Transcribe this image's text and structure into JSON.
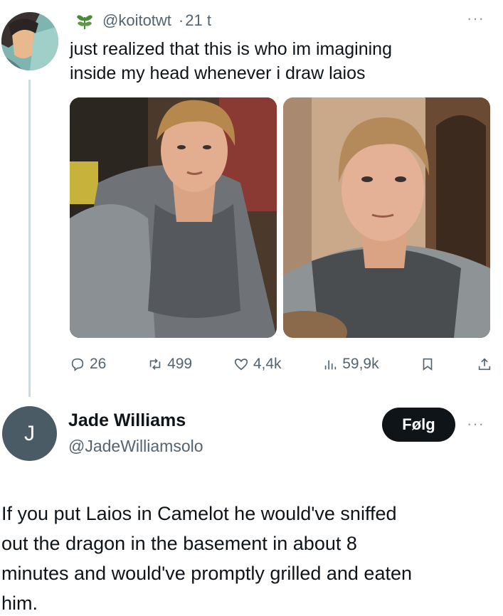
{
  "tweet": {
    "handle": "@koitotwt",
    "separator": "·",
    "time": "21 t",
    "more": "···",
    "text_line1": "just realized that this is who im imagining",
    "text_line2": "inside my head whenever i draw laios",
    "stats": {
      "replies": "26",
      "reposts": "499",
      "likes": "4,4k",
      "views": "59,9k"
    },
    "icons": {
      "badge": "leaf-icon",
      "reply": "reply-icon",
      "repost": "repost-icon",
      "like": "heart-icon",
      "views": "views-icon",
      "bookmark": "bookmark-icon",
      "share": "share-icon"
    }
  },
  "reply": {
    "avatar_letter": "J",
    "name": "Jade Williams",
    "handle": "@JadeWilliamsolo",
    "follow_label": "Følg",
    "more": "···",
    "text_line1": "If you put Laios in Camelot he would've sniffed",
    "text_line2": "out the dragon in the basement in about 8",
    "text_line3": "minutes and would've promptly grilled and eaten",
    "text_line4": "him."
  },
  "colors": {
    "text": "#0f1419",
    "secondary": "#536471",
    "thread_line": "#cfd9de",
    "follow_bg": "#0f1419",
    "avatar_bg": "#4a5b66",
    "leaf": "#4a8a3a"
  }
}
